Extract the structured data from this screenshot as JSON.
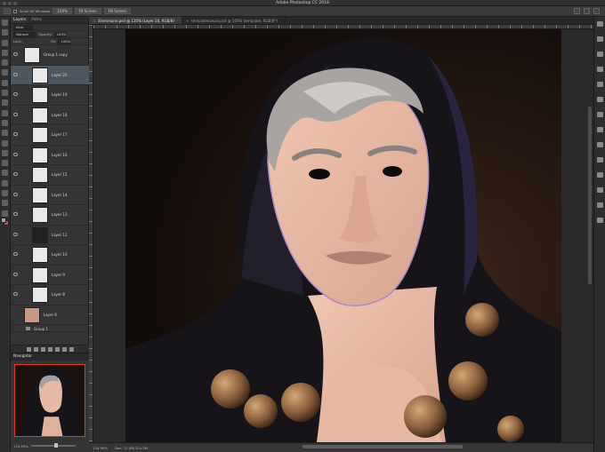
{
  "window": {
    "title": "Adobe Photoshop CC 2018"
  },
  "options_bar": {
    "scroll_all_windows": "Scroll All Windows",
    "zoom_value": "100%",
    "fit_screen": "Fit Screen",
    "fill_screen": "Fill Screen"
  },
  "layers_panel": {
    "tabs": [
      "Layers",
      "Paths"
    ],
    "kind_filter": "Kind",
    "blend_mode": "Normal",
    "opacity_label": "Opacity:",
    "opacity_value": "100%",
    "lock_label": "Lock:",
    "fill_label": "Fill:",
    "fill_value": "100%",
    "group_copy_name": "Group 1 copy",
    "layers": [
      "Layer 20",
      "Layer 19",
      "Layer 18",
      "Layer 17",
      "Layer 16",
      "Layer 15",
      "Layer 14",
      "Layer 13",
      "Layer 12",
      "Layer 10",
      "Layer 9",
      "Layer 8",
      "Layer 6"
    ],
    "selected_layer": "Layer 20",
    "group_name": "Group 1"
  },
  "navigator": {
    "title": "Navigator",
    "zoom": "134.99%"
  },
  "documents": {
    "tabs": [
      {
        "label": "Eisenmann.psd @ 135% (Layer 20, RGB/8)",
        "active": true
      },
      {
        "label": "templatekawaii.psd @ 100% (template, RGB/8*)",
        "active": false
      }
    ]
  },
  "status_bar": {
    "zoom": "134.99%",
    "doc": "Doc: 11.4M/324.3M"
  },
  "colors": {
    "accent_red": "#d43a2f",
    "selection": "#4e5760",
    "canvas_bg": "#1b1210",
    "hood": "#161418",
    "skin": "#e6b9a4"
  }
}
